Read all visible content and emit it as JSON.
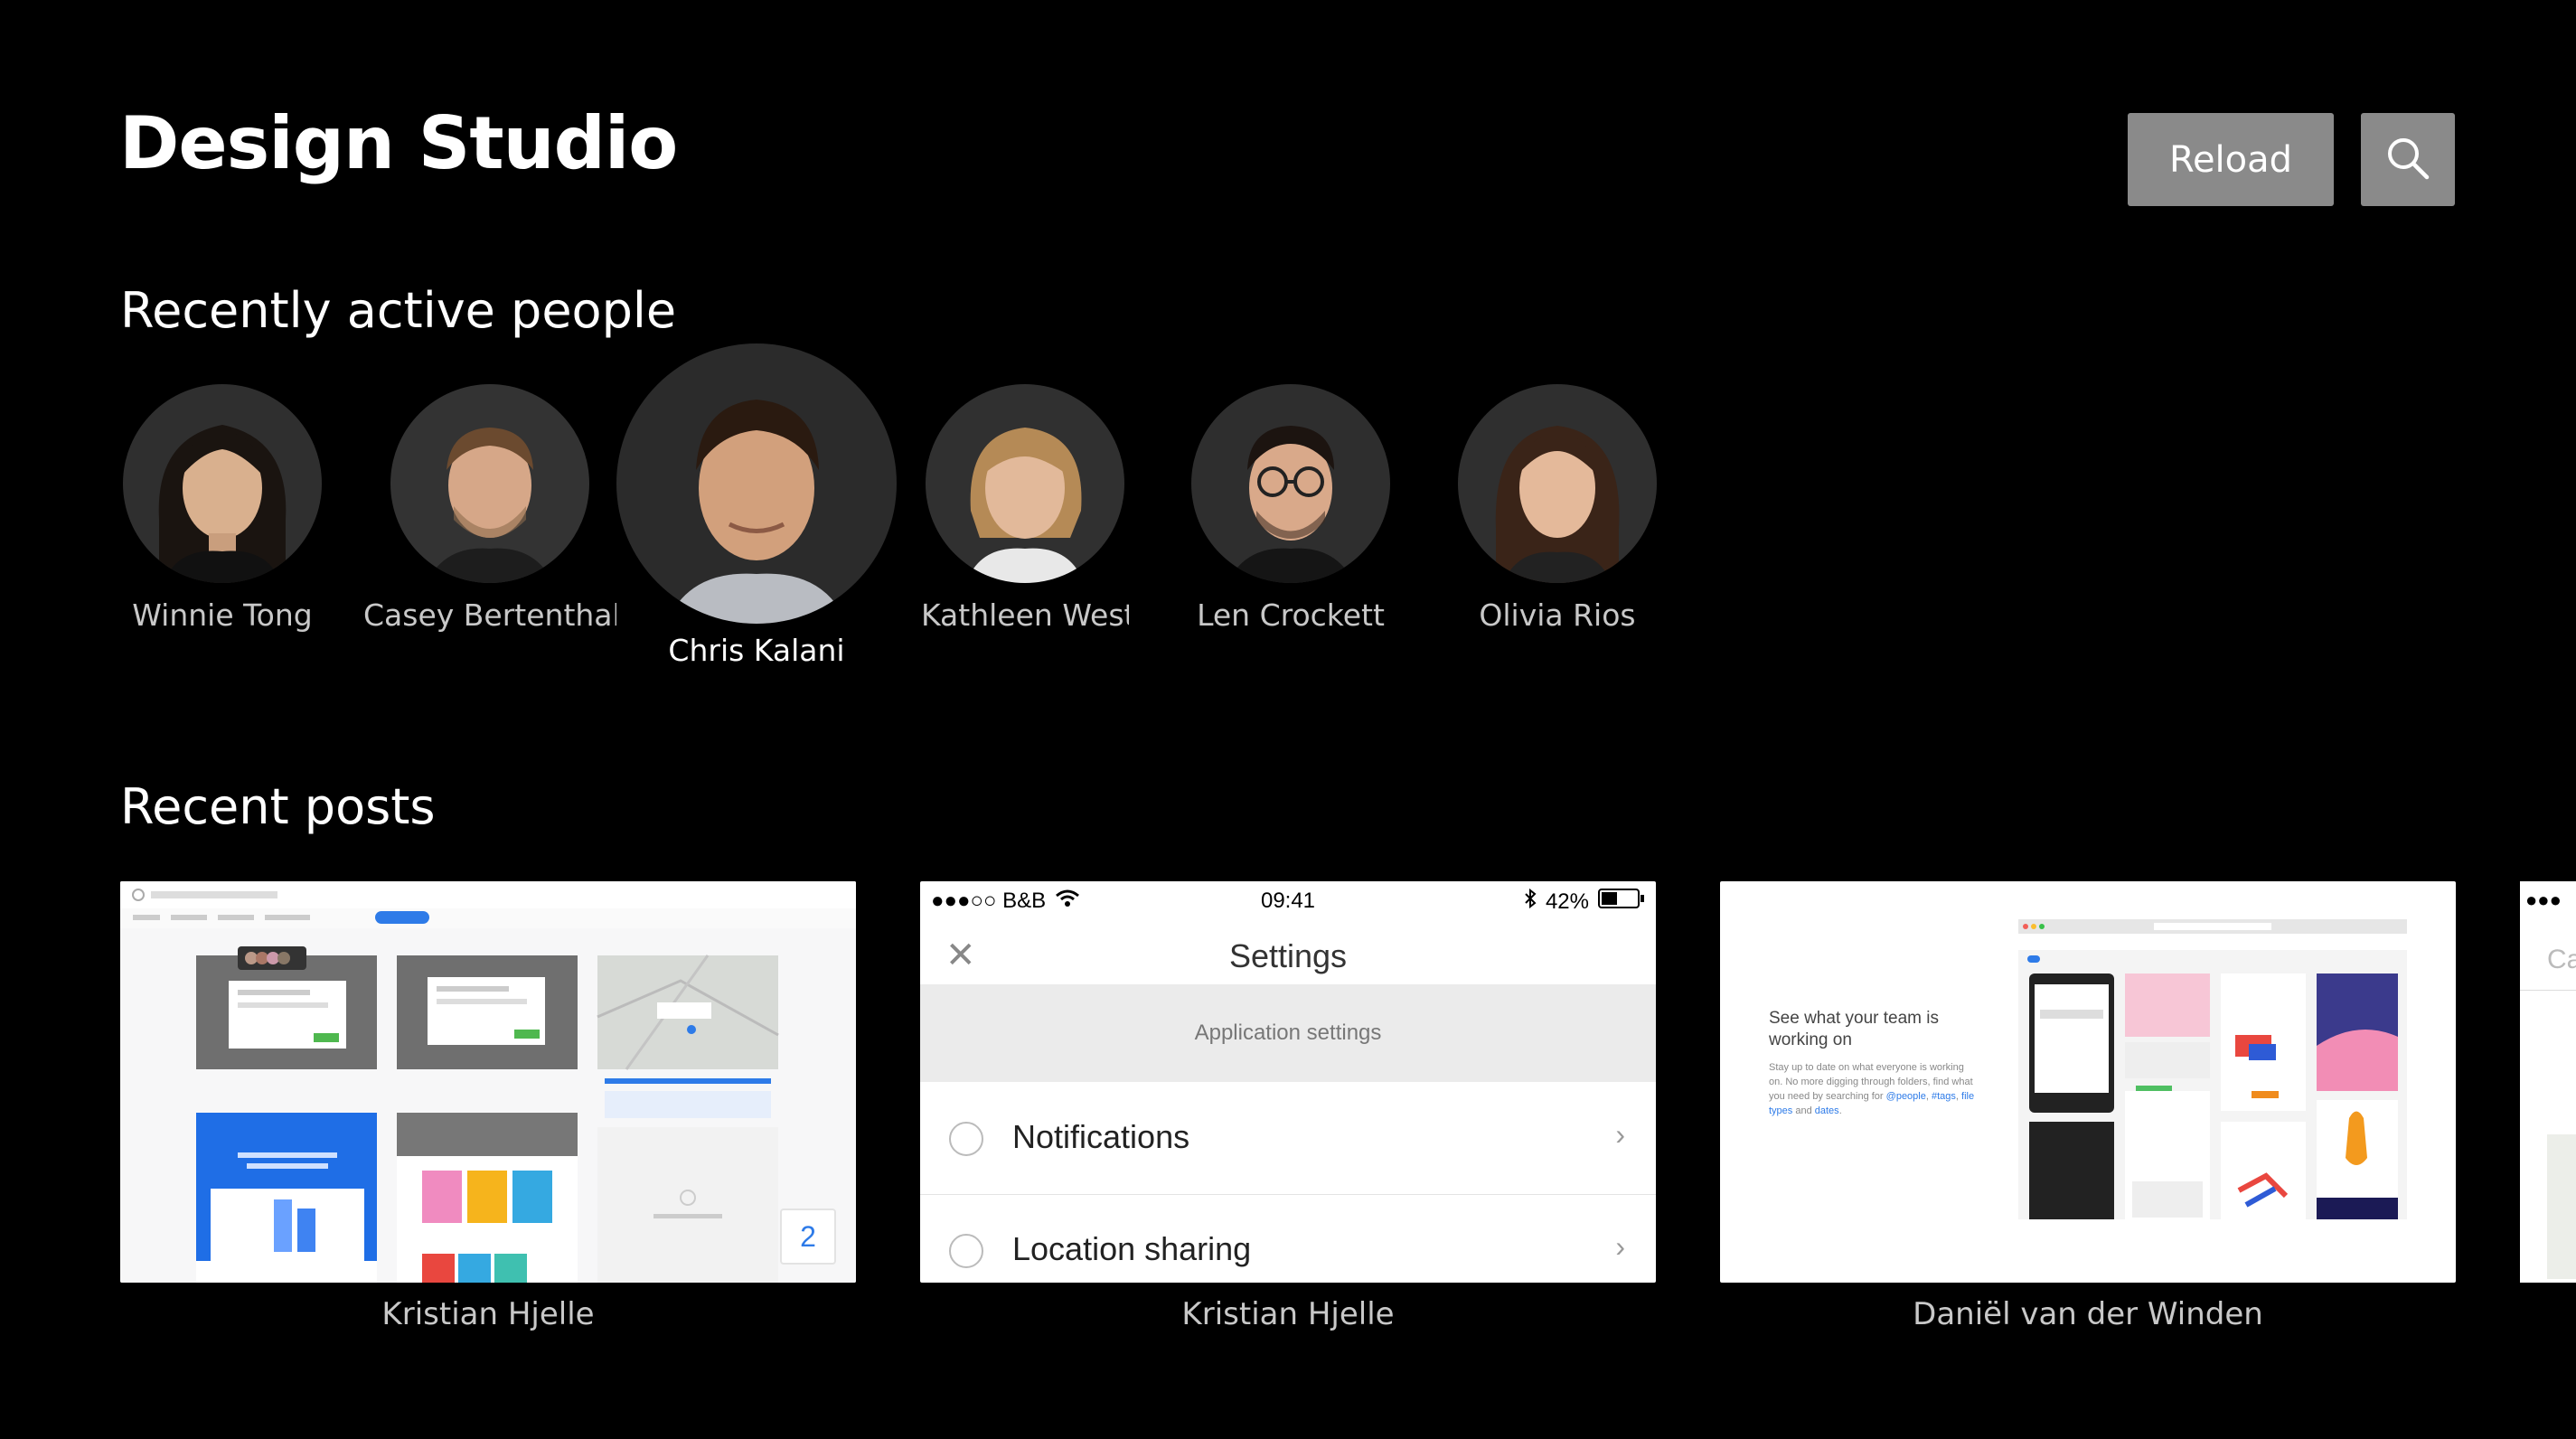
{
  "header": {
    "title": "Design Studio",
    "reload_label": "Reload"
  },
  "people_section": {
    "title": "Recently active people",
    "people": [
      {
        "name": "Winnie Tong"
      },
      {
        "name": "Casey Bertenthal"
      },
      {
        "name": "Chris Kalani"
      },
      {
        "name": "Kathleen West"
      },
      {
        "name": "Len Crockett"
      },
      {
        "name": "Olivia Rios"
      }
    ]
  },
  "posts_section": {
    "title": "Recent posts",
    "posts": [
      {
        "author": "Kristian Hjelle",
        "badge": "2"
      },
      {
        "author": "Kristian Hjelle"
      },
      {
        "author": "Daniël van der Winden"
      }
    ]
  },
  "ios_settings": {
    "carrier": "●●●○○ B&B",
    "time": "09:41",
    "battery": "42%",
    "title": "Settings",
    "section": "Application settings",
    "rows": [
      "Notifications",
      "Location sharing"
    ]
  },
  "card3": {
    "headline": "See what your team is working on",
    "body": "Stay up to date on what everyone is working on. No more digging through folders, find what you need by searching for",
    "links": [
      "@people",
      "#tags",
      "file types",
      "dates"
    ]
  },
  "card4": {
    "carrier": "●●●",
    "label": "Ca"
  },
  "icons": {
    "search": "search-icon",
    "close": "close-icon",
    "chevron": "chevron-right-icon"
  },
  "colors": {
    "background": "#000000",
    "button": "#8a8a8a",
    "accent": "#2e7be8"
  }
}
